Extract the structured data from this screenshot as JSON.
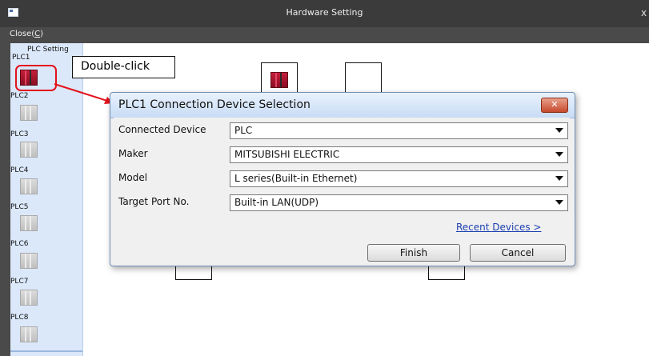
{
  "window": {
    "title": "Hardware Setting",
    "close_glyph": "x"
  },
  "menu": {
    "close_label": "Close(",
    "close_mnemonic": "C",
    "close_suffix": ")"
  },
  "sidebar": {
    "header_line1": "PLC Setting",
    "items": [
      {
        "label": "PLC1",
        "icon": "plc-icon-red"
      },
      {
        "label": "PLC2",
        "icon": "plc-icon-gray"
      },
      {
        "label": "PLC3",
        "icon": "plc-icon-gray"
      },
      {
        "label": "PLC4",
        "icon": "plc-icon-gray"
      },
      {
        "label": "PLC5",
        "icon": "plc-icon-gray"
      },
      {
        "label": "PLC6",
        "icon": "plc-icon-gray"
      },
      {
        "label": "PLC7",
        "icon": "plc-icon-gray"
      },
      {
        "label": "PLC8",
        "icon": "plc-icon-gray"
      }
    ]
  },
  "callout": {
    "text": "Double-click",
    "highlight_color": "#e3121b"
  },
  "dialog": {
    "title": "PLC1 Connection Device Selection",
    "close_glyph": "✕",
    "fields": [
      {
        "label": "Connected Device",
        "value": "PLC"
      },
      {
        "label": "Maker",
        "value": "MITSUBISHI ELECTRIC"
      },
      {
        "label": "Model",
        "value": "L series(Built-in Ethernet)"
      },
      {
        "label": "Target Port No.",
        "value": "Built-in LAN(UDP)"
      }
    ],
    "recent_link": "Recent Devices >",
    "finish_label": "Finish",
    "cancel_label": "Cancel"
  },
  "colors": {
    "titlebar": "#3b3b3b",
    "sidebar": "#dbe8fa",
    "link": "#1a3fb0"
  }
}
